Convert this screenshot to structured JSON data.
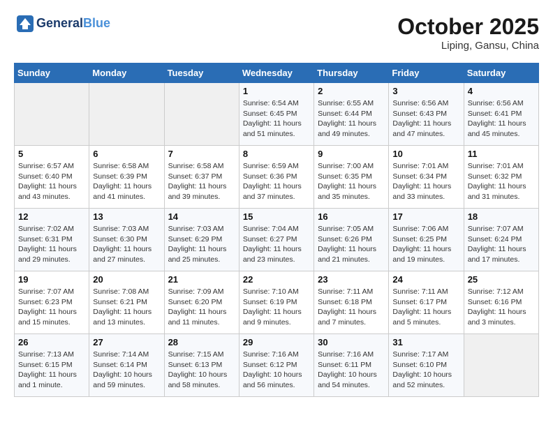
{
  "header": {
    "logo_line1": "General",
    "logo_line2": "Blue",
    "month": "October 2025",
    "location": "Liping, Gansu, China"
  },
  "weekdays": [
    "Sunday",
    "Monday",
    "Tuesday",
    "Wednesday",
    "Thursday",
    "Friday",
    "Saturday"
  ],
  "weeks": [
    [
      {
        "day": "",
        "info": ""
      },
      {
        "day": "",
        "info": ""
      },
      {
        "day": "",
        "info": ""
      },
      {
        "day": "1",
        "info": "Sunrise: 6:54 AM\nSunset: 6:45 PM\nDaylight: 11 hours\nand 51 minutes."
      },
      {
        "day": "2",
        "info": "Sunrise: 6:55 AM\nSunset: 6:44 PM\nDaylight: 11 hours\nand 49 minutes."
      },
      {
        "day": "3",
        "info": "Sunrise: 6:56 AM\nSunset: 6:43 PM\nDaylight: 11 hours\nand 47 minutes."
      },
      {
        "day": "4",
        "info": "Sunrise: 6:56 AM\nSunset: 6:41 PM\nDaylight: 11 hours\nand 45 minutes."
      }
    ],
    [
      {
        "day": "5",
        "info": "Sunrise: 6:57 AM\nSunset: 6:40 PM\nDaylight: 11 hours\nand 43 minutes."
      },
      {
        "day": "6",
        "info": "Sunrise: 6:58 AM\nSunset: 6:39 PM\nDaylight: 11 hours\nand 41 minutes."
      },
      {
        "day": "7",
        "info": "Sunrise: 6:58 AM\nSunset: 6:37 PM\nDaylight: 11 hours\nand 39 minutes."
      },
      {
        "day": "8",
        "info": "Sunrise: 6:59 AM\nSunset: 6:36 PM\nDaylight: 11 hours\nand 37 minutes."
      },
      {
        "day": "9",
        "info": "Sunrise: 7:00 AM\nSunset: 6:35 PM\nDaylight: 11 hours\nand 35 minutes."
      },
      {
        "day": "10",
        "info": "Sunrise: 7:01 AM\nSunset: 6:34 PM\nDaylight: 11 hours\nand 33 minutes."
      },
      {
        "day": "11",
        "info": "Sunrise: 7:01 AM\nSunset: 6:32 PM\nDaylight: 11 hours\nand 31 minutes."
      }
    ],
    [
      {
        "day": "12",
        "info": "Sunrise: 7:02 AM\nSunset: 6:31 PM\nDaylight: 11 hours\nand 29 minutes."
      },
      {
        "day": "13",
        "info": "Sunrise: 7:03 AM\nSunset: 6:30 PM\nDaylight: 11 hours\nand 27 minutes."
      },
      {
        "day": "14",
        "info": "Sunrise: 7:03 AM\nSunset: 6:29 PM\nDaylight: 11 hours\nand 25 minutes."
      },
      {
        "day": "15",
        "info": "Sunrise: 7:04 AM\nSunset: 6:27 PM\nDaylight: 11 hours\nand 23 minutes."
      },
      {
        "day": "16",
        "info": "Sunrise: 7:05 AM\nSunset: 6:26 PM\nDaylight: 11 hours\nand 21 minutes."
      },
      {
        "day": "17",
        "info": "Sunrise: 7:06 AM\nSunset: 6:25 PM\nDaylight: 11 hours\nand 19 minutes."
      },
      {
        "day": "18",
        "info": "Sunrise: 7:07 AM\nSunset: 6:24 PM\nDaylight: 11 hours\nand 17 minutes."
      }
    ],
    [
      {
        "day": "19",
        "info": "Sunrise: 7:07 AM\nSunset: 6:23 PM\nDaylight: 11 hours\nand 15 minutes."
      },
      {
        "day": "20",
        "info": "Sunrise: 7:08 AM\nSunset: 6:21 PM\nDaylight: 11 hours\nand 13 minutes."
      },
      {
        "day": "21",
        "info": "Sunrise: 7:09 AM\nSunset: 6:20 PM\nDaylight: 11 hours\nand 11 minutes."
      },
      {
        "day": "22",
        "info": "Sunrise: 7:10 AM\nSunset: 6:19 PM\nDaylight: 11 hours\nand 9 minutes."
      },
      {
        "day": "23",
        "info": "Sunrise: 7:11 AM\nSunset: 6:18 PM\nDaylight: 11 hours\nand 7 minutes."
      },
      {
        "day": "24",
        "info": "Sunrise: 7:11 AM\nSunset: 6:17 PM\nDaylight: 11 hours\nand 5 minutes."
      },
      {
        "day": "25",
        "info": "Sunrise: 7:12 AM\nSunset: 6:16 PM\nDaylight: 11 hours\nand 3 minutes."
      }
    ],
    [
      {
        "day": "26",
        "info": "Sunrise: 7:13 AM\nSunset: 6:15 PM\nDaylight: 11 hours\nand 1 minute."
      },
      {
        "day": "27",
        "info": "Sunrise: 7:14 AM\nSunset: 6:14 PM\nDaylight: 10 hours\nand 59 minutes."
      },
      {
        "day": "28",
        "info": "Sunrise: 7:15 AM\nSunset: 6:13 PM\nDaylight: 10 hours\nand 58 minutes."
      },
      {
        "day": "29",
        "info": "Sunrise: 7:16 AM\nSunset: 6:12 PM\nDaylight: 10 hours\nand 56 minutes."
      },
      {
        "day": "30",
        "info": "Sunrise: 7:16 AM\nSunset: 6:11 PM\nDaylight: 10 hours\nand 54 minutes."
      },
      {
        "day": "31",
        "info": "Sunrise: 7:17 AM\nSunset: 6:10 PM\nDaylight: 10 hours\nand 52 minutes."
      },
      {
        "day": "",
        "info": ""
      }
    ]
  ]
}
